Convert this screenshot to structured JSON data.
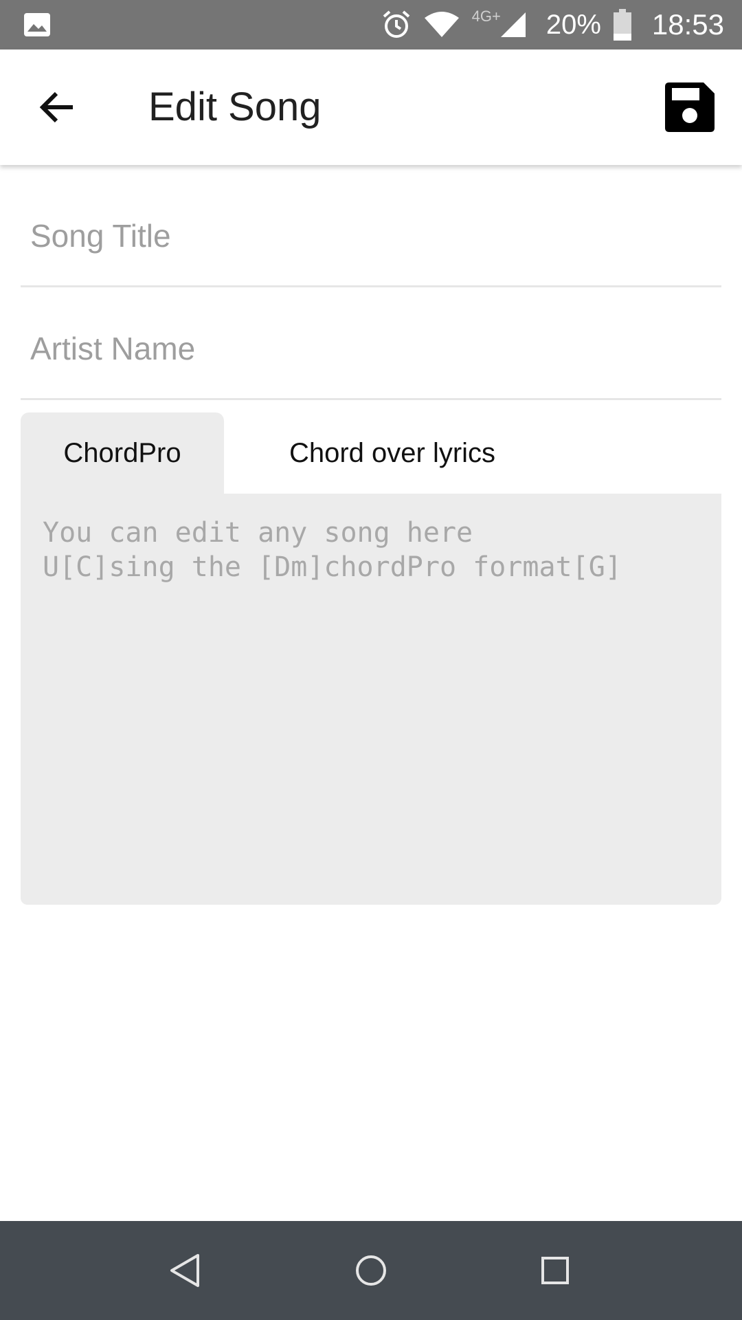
{
  "status_bar": {
    "left_icon": "gallery-icon",
    "icons": [
      "alarm-icon",
      "wifi-icon",
      "signal-icon",
      "battery-icon"
    ],
    "network_type": "4G+",
    "battery_percent": "20%",
    "time": "18:53"
  },
  "app_bar": {
    "back_icon": "arrow-back-icon",
    "title": "Edit Song",
    "save_icon": "floppy-disk-save-icon"
  },
  "form": {
    "song_title": {
      "value": "",
      "placeholder": "Song Title"
    },
    "artist_name": {
      "value": "",
      "placeholder": "Artist Name"
    }
  },
  "tabs": [
    {
      "label": "ChordPro",
      "selected": true
    },
    {
      "label": "Chord over lyrics",
      "selected": false
    }
  ],
  "editor": {
    "value": "",
    "placeholder": "You can edit any song here\nU[C]sing the [Dm]chordPro format[G]"
  },
  "nav_bar": {
    "icons": [
      "back-triangle-icon",
      "home-circle-icon",
      "recents-square-icon"
    ]
  },
  "colors": {
    "status_bar": "#757575",
    "nav_bar": "#454b51",
    "editor_background": "#ececec",
    "placeholder": "#9e9e9e"
  }
}
